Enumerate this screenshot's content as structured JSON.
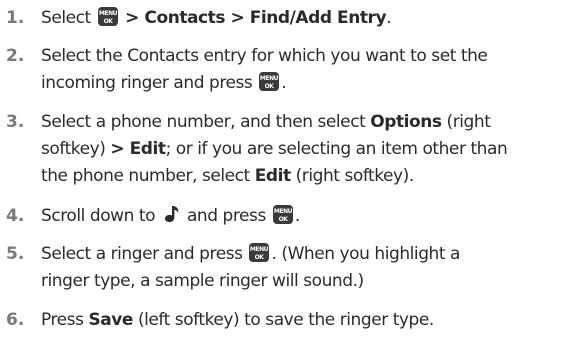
{
  "steps": [
    {
      "number": "1.",
      "parts": {
        "a": "Select ",
        "b": " > Contacts > Find/Add Entry",
        "c": "."
      }
    },
    {
      "number": "2.",
      "line1": "Select the Contacts entry for which you want to set the",
      "line2a": "incoming ringer and press ",
      "line2b": "."
    },
    {
      "number": "3.",
      "line1a": "Select a phone number, and then select ",
      "line1b": "Options",
      "line1c": " (right",
      "line2a": "softkey) ",
      "line2b": "> Edit",
      "line2c": "; or if you are selecting an item other than",
      "line3a": "the phone number, select ",
      "line3b": "Edit",
      "line3c": " (right softkey)."
    },
    {
      "number": "4.",
      "a": "Scroll down to ",
      "b": " and press ",
      "c": "."
    },
    {
      "number": "5.",
      "line1a": "Select a ringer and press ",
      "line1b": ". (When you highlight a",
      "line2": "ringer type, a sample ringer will sound.)"
    },
    {
      "number": "6.",
      "a": "Press ",
      "b": "Save",
      "c": " (left softkey) to save the ringer type."
    }
  ],
  "icons": {
    "menu_ok_key": "menu-ok-key-icon",
    "ringer": "ringer-note-icon"
  },
  "colors": {
    "text": "#2b2b2b",
    "number": "#7a7a7a",
    "key_bg": "#3a3a3a"
  }
}
